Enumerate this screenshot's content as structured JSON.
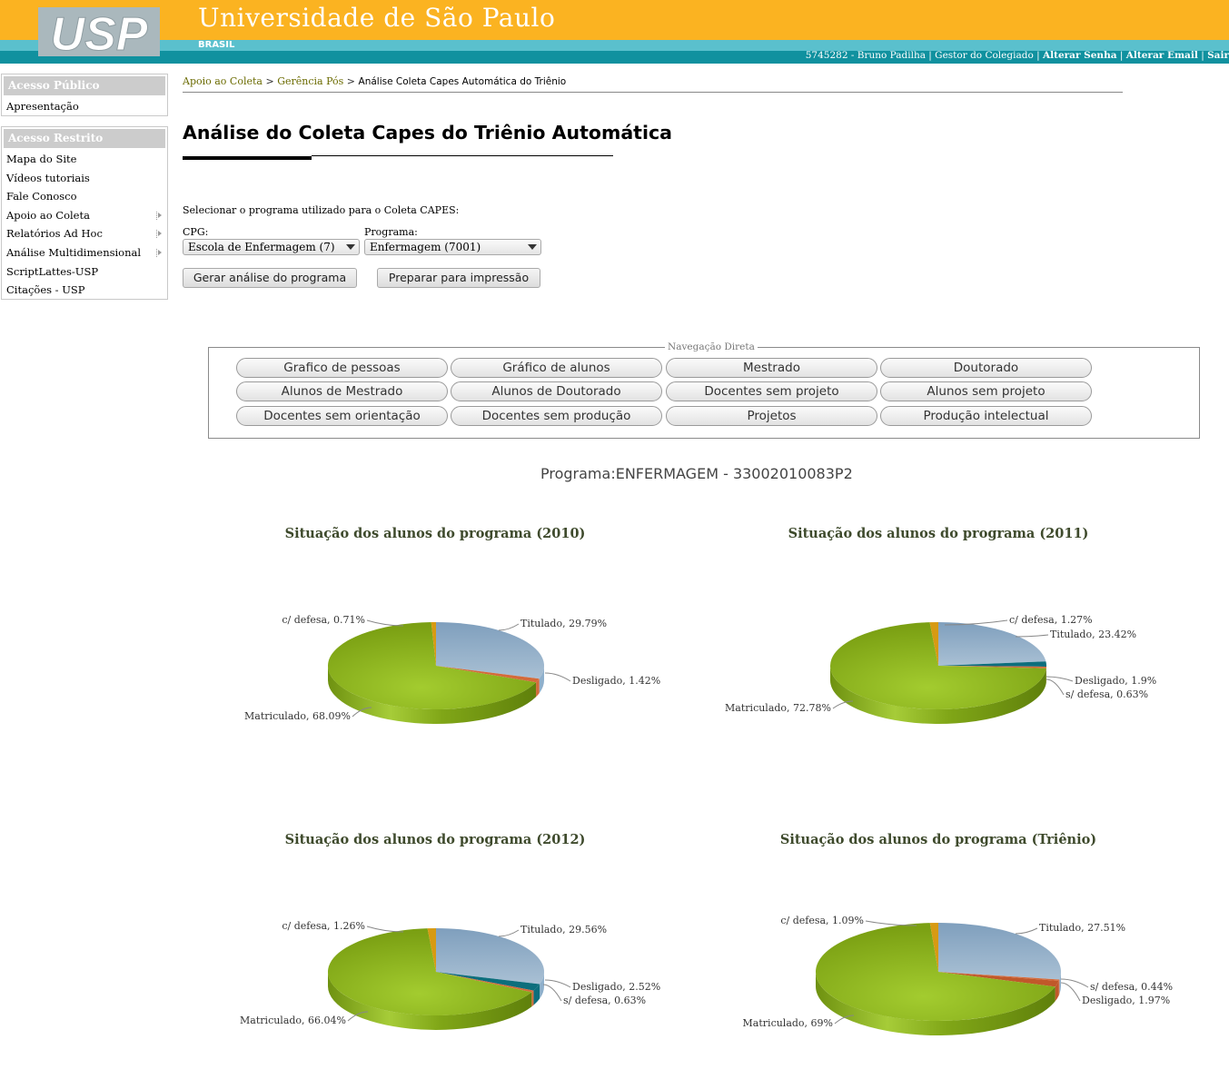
{
  "header": {
    "logo_text": "USP",
    "title": "Universidade de São Paulo",
    "subtitle": "BRASIL",
    "user_info": "5745282 - Bruno Padilha | Gestor do Colegiado |",
    "links": [
      "Alterar Senha",
      "Alterar Email",
      "Sair"
    ],
    "separator": "|"
  },
  "sidebar": {
    "public": {
      "heading": "Acesso Público",
      "items": [
        {
          "label": "Apresentação",
          "has_submenu": false
        }
      ]
    },
    "restricted": {
      "heading": "Acesso Restrito",
      "items": [
        {
          "label": "Mapa do Site",
          "has_submenu": false
        },
        {
          "label": "Vídeos tutoriais",
          "has_submenu": false
        },
        {
          "label": "Fale Conosco",
          "has_submenu": false
        },
        {
          "label": "Apoio ao Coleta",
          "has_submenu": true
        },
        {
          "label": "Relatórios Ad Hoc",
          "has_submenu": true
        },
        {
          "label": "Análise Multidimensional",
          "has_submenu": true
        },
        {
          "label": "ScriptLattes-USP",
          "has_submenu": false
        },
        {
          "label": "Citações - USP",
          "has_submenu": false
        }
      ]
    }
  },
  "breadcrumb": {
    "links": [
      "Apoio ao Coleta",
      "Gerência Pós"
    ],
    "separator": ">",
    "current": "Análise Coleta Capes Automática do Triênio"
  },
  "page": {
    "title": "Análise do Coleta Capes do Triênio Automática",
    "select_prompt": "Selecionar o programa utilizado para o Coleta CAPES:",
    "cpg_label": "CPG:",
    "cpg_value": "Escola de Enfermagem (7)",
    "programa_label": "Programa:",
    "programa_value": "Enfermagem (7001)",
    "generate_button": "Gerar análise do programa",
    "print_button": "Preparar para impressão"
  },
  "nav": {
    "legend": "Navegação Direta",
    "buttons": [
      "Grafico de pessoas",
      "Gráfico de alunos",
      "Mestrado",
      "Doutorado",
      "Alunos de Mestrado",
      "Alunos de Doutorado",
      "Docentes sem projeto",
      "Alunos sem projeto",
      "Docentes sem orientação",
      "Docentes sem produção",
      "Projetos",
      "Produção intelectual"
    ]
  },
  "program": {
    "label": "Programa:",
    "value": "ENFERMAGEM - 33002010083P2"
  },
  "colors": {
    "header_orange": "#fbb321",
    "header_cyan": "#5ac0cd",
    "header_teal": "#10919f",
    "chart_title": "#3e4a2c",
    "breadcrumb_link": "#6b6b00"
  },
  "chart_data": [
    {
      "type": "pie",
      "title": "Situação dos alunos do programa (2010)",
      "slices": [
        {
          "label": "Titulado",
          "value": 29.79,
          "text": "Titulado,  29.79%",
          "color": "#8fb0cc"
        },
        {
          "label": "Desligado",
          "value": 1.42,
          "text": "Desligado,  1.42%",
          "color": "#d46a3a"
        },
        {
          "label": "Matriculado",
          "value": 68.09,
          "text": "Matriculado,  68.09%",
          "color": "#87b017"
        },
        {
          "label": "c/ defesa",
          "value": 0.71,
          "text": "c/ defesa,  0.71%",
          "color": "#d79a12"
        }
      ]
    },
    {
      "type": "pie",
      "title": "Situação dos alunos do programa (2011)",
      "slices": [
        {
          "label": "Titulado",
          "value": 23.42,
          "text": "Titulado,  23.42%",
          "color": "#8fb0cc"
        },
        {
          "label": "Desligado",
          "value": 1.9,
          "text": "Desligado,  1.9%",
          "color": "#0d6e7c"
        },
        {
          "label": "s/ defesa",
          "value": 0.63,
          "text": "s/ defesa,  0.63%",
          "color": "#d46a3a"
        },
        {
          "label": "Matriculado",
          "value": 72.78,
          "text": "Matriculado,  72.78%",
          "color": "#87b017"
        },
        {
          "label": "c/ defesa",
          "value": 1.27,
          "text": "c/ defesa,  1.27%",
          "color": "#d79a12"
        }
      ]
    },
    {
      "type": "pie",
      "title": "Situação dos alunos do programa (2012)",
      "slices": [
        {
          "label": "Titulado",
          "value": 29.56,
          "text": "Titulado,  29.56%",
          "color": "#8fb0cc"
        },
        {
          "label": "Desligado",
          "value": 2.52,
          "text": "Desligado,  2.52%",
          "color": "#0d6e7c"
        },
        {
          "label": "s/ defesa",
          "value": 0.63,
          "text": "s/ defesa,  0.63%",
          "color": "#d46a3a"
        },
        {
          "label": "Matriculado",
          "value": 66.04,
          "text": "Matriculado,  66.04%",
          "color": "#87b017"
        },
        {
          "label": "c/ defesa",
          "value": 1.26,
          "text": "c/ defesa,  1.26%",
          "color": "#d79a12"
        }
      ]
    },
    {
      "type": "pie",
      "title": "Situação dos alunos do programa (Triênio)",
      "slices": [
        {
          "label": "Titulado",
          "value": 27.51,
          "text": "Titulado,  27.51%",
          "color": "#8fb0cc"
        },
        {
          "label": "s/ defesa",
          "value": 0.44,
          "text": "s/ defesa,  0.44%",
          "color": "#d46a3a"
        },
        {
          "label": "Desligado",
          "value": 1.97,
          "text": "Desligado,  1.97%",
          "color": "#c0582a"
        },
        {
          "label": "Matriculado",
          "value": 69,
          "text": "Matriculado,  69%",
          "color": "#87b017"
        },
        {
          "label": "c/ defesa",
          "value": 1.09,
          "text": "c/ defesa,  1.09%",
          "color": "#d79a12"
        }
      ]
    }
  ]
}
